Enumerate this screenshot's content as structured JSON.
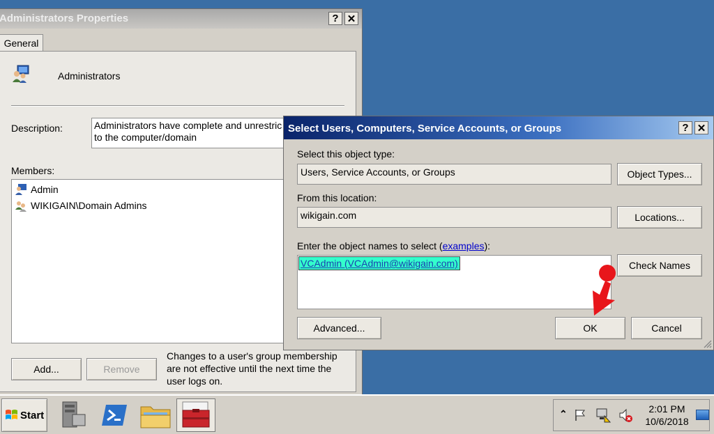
{
  "admin_window": {
    "title": "Administrators Properties",
    "tab_general": "General",
    "group_name": "Administrators",
    "description_label": "Description:",
    "description_value": "Administrators have complete and unrestric",
    "description_value_line2": "to the computer/domain",
    "members_label": "Members:",
    "members": [
      "Admin",
      "WIKIGAIN\\Domain Admins"
    ],
    "add_button": "Add...",
    "remove_button": "Remove",
    "note_line1": "Changes to a user's group membership",
    "note_line2": "are not effective until the next time the",
    "note_line3": "user logs on."
  },
  "select_dialog": {
    "title": "Select Users, Computers, Service Accounts, or Groups",
    "object_type_label": "Select this object type:",
    "object_type_value": "Users, Service Accounts, or Groups",
    "object_types_button": "Object Types...",
    "location_label": "From this location:",
    "location_value": "wikigain.com",
    "locations_button": "Locations...",
    "names_label_prefix": "Enter the object names to select (",
    "names_label_link": "examples",
    "names_label_suffix": "):",
    "names_value": "VCAdmin (VCAdmin@wikigain.com)",
    "check_names_button": "Check Names",
    "advanced_button": "Advanced...",
    "ok_button": "OK",
    "cancel_button": "Cancel"
  },
  "taskbar": {
    "start_label": "Start",
    "time": "2:01 PM",
    "date": "10/6/2018",
    "apps": [
      "server-manager-icon",
      "powershell-icon",
      "explorer-icon",
      "toolbox-icon"
    ]
  },
  "colors": {
    "desktop": "#3a6ea5",
    "selection": "#33ffcc",
    "pointer_arrow": "#e8161b",
    "dialog_title_active": "#0a246a"
  }
}
